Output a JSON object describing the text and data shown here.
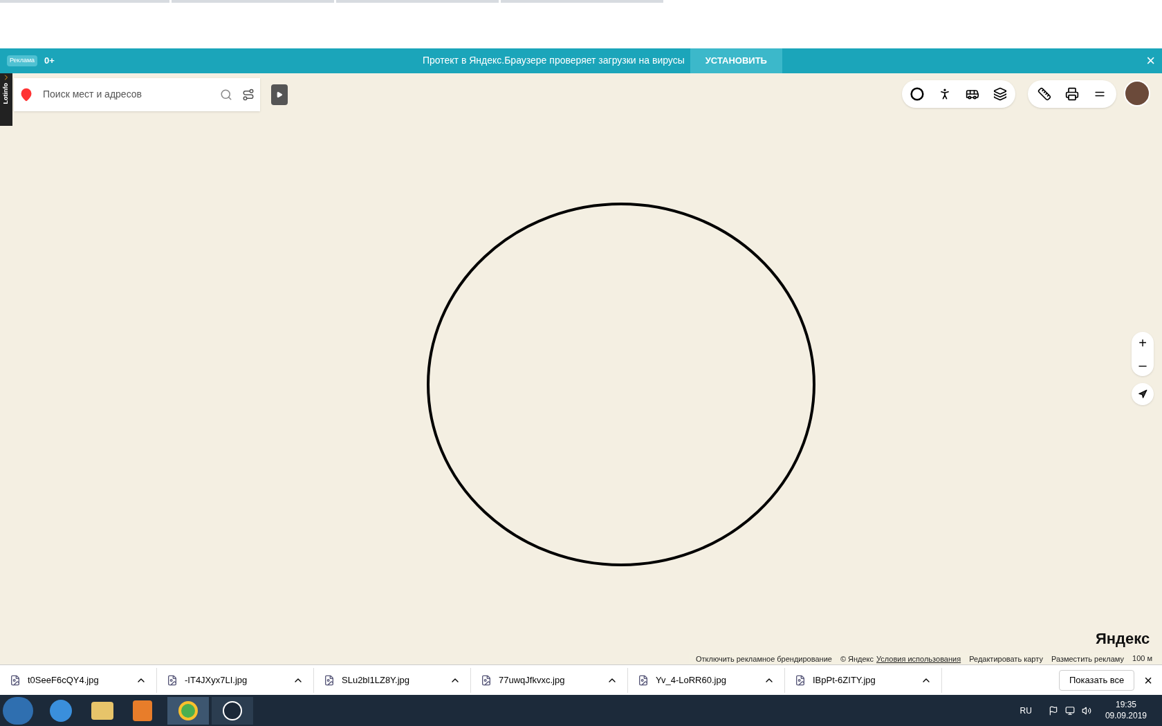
{
  "banner": {
    "ad_badge": "Реклама",
    "age": "0+",
    "message": "Протект в Яндекс.Браузере проверяет загрузки на вирусы",
    "action": "УСТАНОВИТЬ",
    "close": "×"
  },
  "side_tab": {
    "label": "Lotinfo"
  },
  "search": {
    "placeholder": "Поиск мест и адресов"
  },
  "zoom": {
    "plus": "+",
    "minus": "–"
  },
  "map_footer": {
    "disable_branding": "Отключить рекламное брендирование",
    "copyright": "© Яндекс",
    "terms": "Условия использования",
    "edit": "Редактировать карту",
    "advertise": "Разместить рекламу",
    "scale": "100 м",
    "logo": "Яндекс"
  },
  "downloads": {
    "items": [
      {
        "name": "t0SeeF6cQY4.jpg"
      },
      {
        "name": "-IT4JXyx7LI.jpg"
      },
      {
        "name": "SLu2bl1LZ8Y.jpg"
      },
      {
        "name": "77uwqJfkvxc.jpg"
      },
      {
        "name": "Yv_4-LoRR60.jpg"
      },
      {
        "name": "IBpPt-6ZITY.jpg"
      }
    ],
    "show_all": "Показать все",
    "close": "×"
  },
  "taskbar": {
    "language": "RU",
    "time": "19:35",
    "date": "09.09.2019"
  }
}
